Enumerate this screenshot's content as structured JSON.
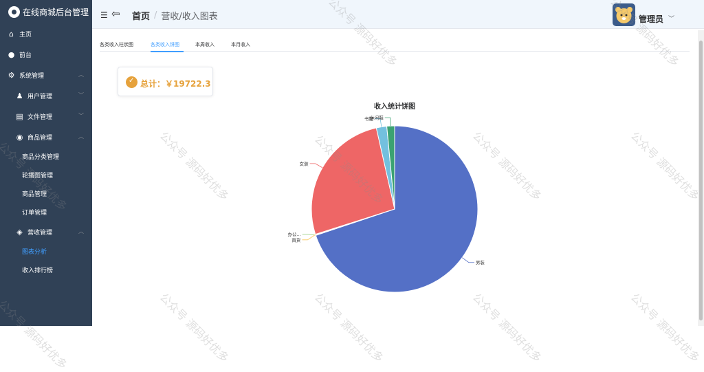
{
  "sidebar": {
    "title": "在线商城后台管理",
    "items": [
      {
        "label": "主页",
        "icon": "home-icon"
      },
      {
        "label": "前台",
        "icon": "flame-icon"
      },
      {
        "label": "系统管理",
        "icon": "gear-icon"
      },
      {
        "label": "用户管理",
        "icon": "user-icon"
      },
      {
        "label": "文件管理",
        "icon": "file-icon"
      },
      {
        "label": "商品管理",
        "icon": "tag-icon"
      },
      {
        "label": "商品分类管理"
      },
      {
        "label": "轮播图管理"
      },
      {
        "label": "商品管理"
      },
      {
        "label": "订单管理"
      },
      {
        "label": "营收管理",
        "icon": "wallet-icon"
      },
      {
        "label": "图表分析"
      },
      {
        "label": "收入排行榜"
      }
    ]
  },
  "header": {
    "breadcrumb_home": "首页",
    "breadcrumb_sep": "/",
    "breadcrumb_current": "营收/收入图表",
    "user_name": "管理员"
  },
  "tabs": [
    "各类收入柱状图",
    "各类收入饼图",
    "本周收入",
    "本月收入"
  ],
  "total": {
    "label": "总计：￥19722.3"
  },
  "watermark": "公众号 源码好优多",
  "chart_data": {
    "type": "pie",
    "title": "收入统计饼图",
    "slices": [
      {
        "name": "男装",
        "value": 13780,
        "color": "#5470c6"
      },
      {
        "name": "办公",
        "value": 20,
        "color": "#91cc75"
      },
      {
        "name": "百货",
        "value": 25,
        "color": "#fac858"
      },
      {
        "name": "女装",
        "value": 5200,
        "color": "#ee6666"
      },
      {
        "name": "书籍",
        "value": 400,
        "color": "#73c0de"
      },
      {
        "name": "休闲鞋",
        "value": 297.3,
        "color": "#3ba272"
      }
    ],
    "display_labels": [
      "男装",
      "办公...",
      "百货",
      "女装",
      "书籍",
      "休闲鞋"
    ]
  }
}
